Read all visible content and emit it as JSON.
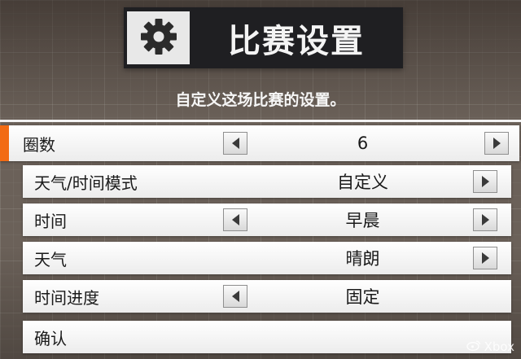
{
  "header": {
    "title": "比赛设置",
    "icon": "gear-icon",
    "subtitle": "自定义这场比赛的设置。"
  },
  "colors": {
    "accent": "#f26b14",
    "title_bg": "#1f1f22",
    "row_bg": "#ffffff"
  },
  "settings": {
    "laps": {
      "label": "圈数",
      "value": "6"
    },
    "weather_time_mode": {
      "label": "天气/时间模式",
      "value": "自定义"
    },
    "time": {
      "label": "时间",
      "value": "早晨"
    },
    "weather": {
      "label": "天气",
      "value": "晴朗"
    },
    "time_progress": {
      "label": "时间进度",
      "value": "固定"
    }
  },
  "confirm": {
    "label": "确认"
  },
  "watermark": {
    "text": "Xbox"
  }
}
